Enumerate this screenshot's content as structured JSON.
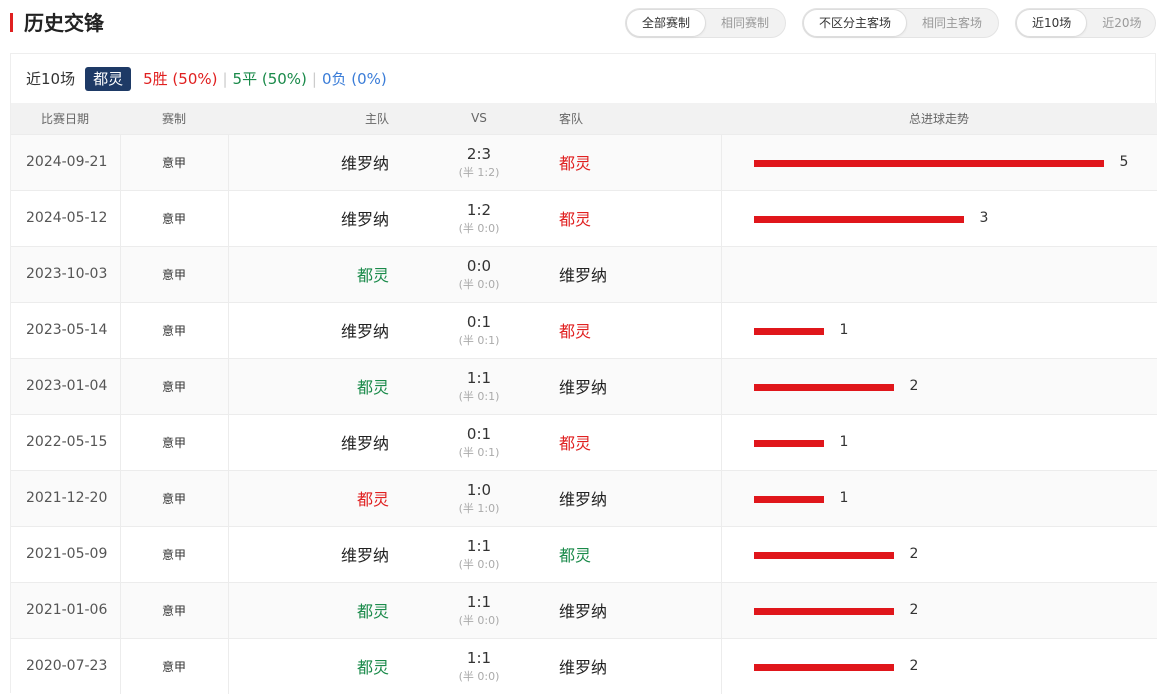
{
  "header": {
    "title": "历史交锋"
  },
  "filters": {
    "competition": [
      "全部赛制",
      "相同赛制"
    ],
    "venue": [
      "不区分主客场",
      "相同主客场"
    ],
    "range": [
      "近10场",
      "近20场"
    ]
  },
  "summary": {
    "recent_label": "近10场",
    "team": "都灵",
    "wins": "5胜 (50%)",
    "draws": "5平 (50%)",
    "losses": "0负 (0%)",
    "separator": "|"
  },
  "table": {
    "headers": {
      "date": "比赛日期",
      "comp": "赛制",
      "home": "主队",
      "vs": "VS",
      "away": "客队",
      "trend": "总进球走势"
    },
    "max_goals": 5,
    "rows": [
      {
        "date": "2024-09-21",
        "comp": "意甲",
        "home": "维罗纳",
        "home_color": "black",
        "score": "2:3",
        "half": "(半 1:2)",
        "away": "都灵",
        "away_color": "red",
        "goals": 5,
        "goals_label": "5"
      },
      {
        "date": "2024-05-12",
        "comp": "意甲",
        "home": "维罗纳",
        "home_color": "black",
        "score": "1:2",
        "half": "(半 0:0)",
        "away": "都灵",
        "away_color": "red",
        "goals": 3,
        "goals_label": "3"
      },
      {
        "date": "2023-10-03",
        "comp": "意甲",
        "home": "都灵",
        "home_color": "green",
        "score": "0:0",
        "half": "(半 0:0)",
        "away": "维罗纳",
        "away_color": "black",
        "goals": 0,
        "goals_label": ""
      },
      {
        "date": "2023-05-14",
        "comp": "意甲",
        "home": "维罗纳",
        "home_color": "black",
        "score": "0:1",
        "half": "(半 0:1)",
        "away": "都灵",
        "away_color": "red",
        "goals": 1,
        "goals_label": "1"
      },
      {
        "date": "2023-01-04",
        "comp": "意甲",
        "home": "都灵",
        "home_color": "green",
        "score": "1:1",
        "half": "(半 0:1)",
        "away": "维罗纳",
        "away_color": "black",
        "goals": 2,
        "goals_label": "2"
      },
      {
        "date": "2022-05-15",
        "comp": "意甲",
        "home": "维罗纳",
        "home_color": "black",
        "score": "0:1",
        "half": "(半 0:1)",
        "away": "都灵",
        "away_color": "red",
        "goals": 1,
        "goals_label": "1"
      },
      {
        "date": "2021-12-20",
        "comp": "意甲",
        "home": "都灵",
        "home_color": "red",
        "score": "1:0",
        "half": "(半 1:0)",
        "away": "维罗纳",
        "away_color": "black",
        "goals": 1,
        "goals_label": "1"
      },
      {
        "date": "2021-05-09",
        "comp": "意甲",
        "home": "维罗纳",
        "home_color": "black",
        "score": "1:1",
        "half": "(半 0:0)",
        "away": "都灵",
        "away_color": "green",
        "goals": 2,
        "goals_label": "2"
      },
      {
        "date": "2021-01-06",
        "comp": "意甲",
        "home": "都灵",
        "home_color": "green",
        "score": "1:1",
        "half": "(半 0:0)",
        "away": "维罗纳",
        "away_color": "black",
        "goals": 2,
        "goals_label": "2"
      },
      {
        "date": "2020-07-23",
        "comp": "意甲",
        "home": "都灵",
        "home_color": "green",
        "score": "1:1",
        "half": "(半 0:0)",
        "away": "维罗纳",
        "away_color": "black",
        "goals": 2,
        "goals_label": "2"
      }
    ]
  },
  "colors": {
    "accent": "#e02020",
    "win": "#e02020",
    "draw": "#1a8a4a",
    "loss": "#3b7dd8",
    "team_badge": "#1e3a66",
    "bar": "#e0161b"
  }
}
